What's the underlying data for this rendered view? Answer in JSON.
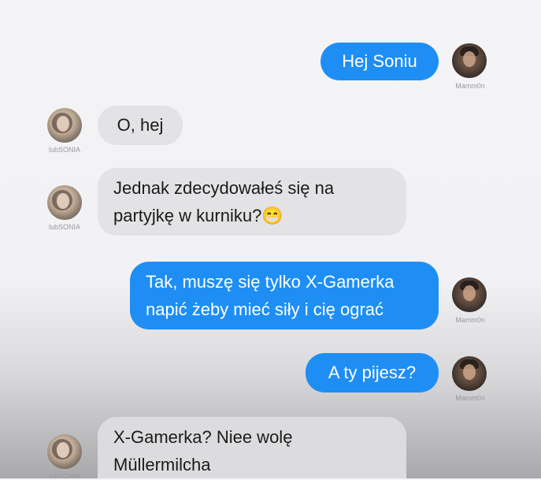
{
  "conversation": {
    "users": {
      "me": "Mamm0n",
      "other": "lubSONIA"
    },
    "messages": [
      {
        "from": "me",
        "lines": [
          "Hej Soniu"
        ]
      },
      {
        "from": "other",
        "lines": [
          "O, hej"
        ]
      },
      {
        "from": "other",
        "lines": [
          "Jednak zdecydowałeś się na",
          "partyjkę w kurniku?"
        ],
        "emoji": "😁"
      },
      {
        "from": "me",
        "lines": [
          "Tak, muszę się tylko X-Gamerka",
          "napić żeby mieć siły i cię ograć"
        ]
      },
      {
        "from": "me",
        "lines": [
          "A ty pijesz?"
        ]
      },
      {
        "from": "other",
        "lines": [
          "X-Gamerka? Niee wolę",
          "Müllermilcha"
        ]
      }
    ]
  },
  "colors": {
    "outgoing_bubble": "#1e8ef5",
    "incoming_bubble": "#e3e3e5"
  }
}
